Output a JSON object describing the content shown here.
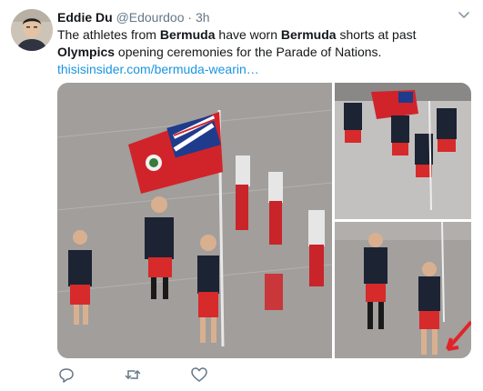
{
  "tweet": {
    "author": {
      "display_name": "Eddie Du",
      "handle": "@Edourdoo",
      "avatar_icon": "avatar-photo"
    },
    "separator": "·",
    "time": "3h",
    "text": {
      "p1": "The athletes from ",
      "b1": "Bermuda",
      "p2": " have worn ",
      "b2": "Bermuda",
      "p3": " shorts at past ",
      "b3": "Olympics",
      "p4": " opening ceremonies for the Parade of Nations."
    },
    "link": "thisisinsider.com/bermuda-wearin…",
    "media": {
      "photo_count": 3
    },
    "actions": {
      "reply_icon": "reply-icon",
      "retweet_icon": "retweet-icon",
      "like_icon": "heart-icon"
    },
    "colors": {
      "link": "#1b95e0",
      "secondary_text": "#657786",
      "action_icon": "#657786"
    }
  }
}
